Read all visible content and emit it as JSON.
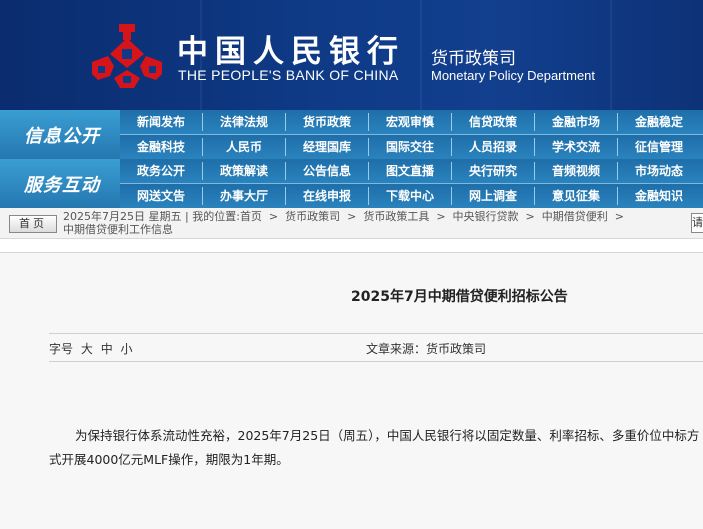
{
  "header": {
    "bank_name_cn": "中国人民银行",
    "bank_name_en": "THE PEOPLE'S BANK OF CHINA",
    "dept_cn": "货币政策司",
    "dept_en": "Monetary Policy Department",
    "logo_icon": "pboc-emblem-icon",
    "logo_color": "#d7141a"
  },
  "nav": {
    "band1": "信息公开",
    "band2": "服务互动",
    "row1": [
      "新闻发布",
      "法律法规",
      "货币政策",
      "宏观审慎",
      "信贷政策",
      "金融市场",
      "金融稳定"
    ],
    "row2": [
      "金融科技",
      "人民币",
      "经理国库",
      "国际交往",
      "人员招录",
      "学术交流",
      "征信管理"
    ],
    "row3": [
      "政务公开",
      "政策解读",
      "公告信息",
      "图文直播",
      "央行研究",
      "音频视频",
      "市场动态"
    ],
    "row4": [
      "网送文告",
      "办事大厅",
      "在线申报",
      "下载中心",
      "网上调查",
      "意见征集",
      "金融知识"
    ]
  },
  "breadcrumb": {
    "home": "首页",
    "date": "2025年7月25日",
    "weekday": "星期五",
    "location_label": "我的位置:",
    "items": [
      "首页",
      "货币政策司",
      "货币政策工具",
      "中央银行贷款",
      "中期借贷便利",
      "中期借贷便利工作信息"
    ],
    "search_stub": "请"
  },
  "article": {
    "title": "2025年7月中期借贷便利招标公告",
    "font_size_label": "字号",
    "font_sizes": [
      "大",
      "中",
      "小"
    ],
    "source_label": "文章来源：",
    "source": "货币政策司",
    "body": "为保持银行体系流动性充裕，2025年7月25日（周五），中国人民银行将以固定数量、利率招标、多重价位中标方式开展4000亿元MLF操作，期限为1年期。"
  },
  "colors": {
    "banner": "#0e3a86",
    "nav": "#2f8bc2",
    "content_bg": "#f7f7f7"
  }
}
